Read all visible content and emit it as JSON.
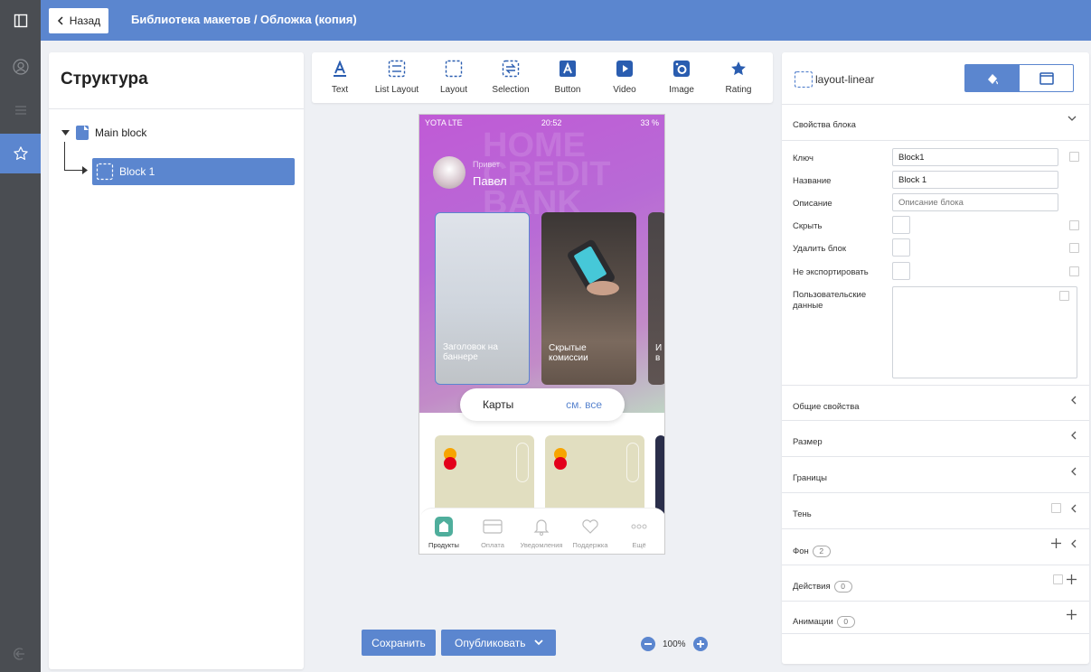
{
  "header": {
    "back_label": "Назад",
    "breadcrumb": "Библиотека макетов / Обложка (копия)"
  },
  "structure": {
    "title": "Структура",
    "main_block": "Main block",
    "child_block": "Block 1"
  },
  "toolbar": {
    "tools": [
      {
        "label": "Text",
        "icon": "text-icon"
      },
      {
        "label": "List Layout",
        "icon": "list-layout-icon"
      },
      {
        "label": "Layout",
        "icon": "layout-icon"
      },
      {
        "label": "Selection",
        "icon": "selection-icon"
      },
      {
        "label": "Button",
        "icon": "button-icon"
      },
      {
        "label": "Video",
        "icon": "video-icon"
      },
      {
        "label": "Image",
        "icon": "image-icon"
      },
      {
        "label": "Rating",
        "icon": "star-icon"
      }
    ]
  },
  "phone": {
    "carrier": "YOTA LTE",
    "time": "20:52",
    "battery": "33 %",
    "watermark": "HOME CREDIT BANK",
    "greeting": "Привет",
    "user_name": "Павел",
    "story1_caption": "Заголовок на баннере",
    "story2_caption": "Скрытые комиссии",
    "story3_caption": "И в",
    "cards_label": "Карты",
    "see_all": "см. все",
    "tabs": [
      "Продукты",
      "Оплата",
      "Уведомления",
      "Поддержка",
      "Ещё"
    ]
  },
  "actions": {
    "save": "Сохранить",
    "publish": "Опубликовать",
    "zoom": "100%"
  },
  "props": {
    "layout_name": "layout-linear",
    "sections": {
      "block_props": "Свойства блока",
      "common": "Общие свойства",
      "size": "Размер",
      "borders": "Границы",
      "shadow": "Тень",
      "background": "Фон",
      "background_count": "2",
      "actions": "Действия",
      "actions_count": "0",
      "animations": "Анимации",
      "animations_count": "0"
    },
    "fields": {
      "key_label": "Ключ",
      "key_value": "Block1",
      "name_label": "Название",
      "name_value": "Block 1",
      "desc_label": "Описание",
      "desc_placeholder": "Описание блока",
      "hide_label": "Скрыть",
      "delete_label": "Удалить блок",
      "noexport_label": "Не экспортировать",
      "userdata_label": "Пользовательские данные"
    }
  },
  "colors": {
    "accent": "#5b86cf",
    "rail": "#4a4d52",
    "panel_bg": "#eef0f4"
  }
}
